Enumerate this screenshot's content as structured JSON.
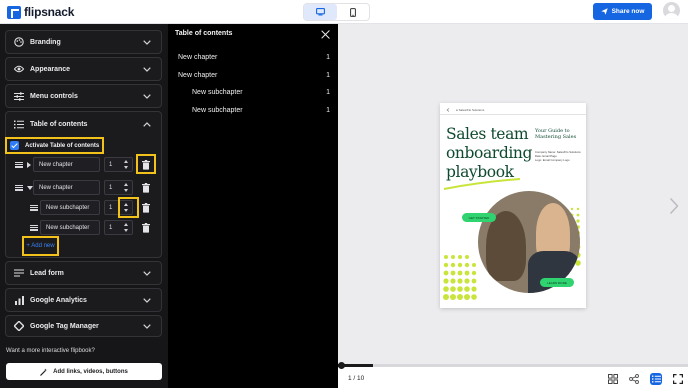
{
  "topbar": {
    "logo_text": "flipsnack",
    "share_label": "Share now",
    "devices": [
      "desktop-icon",
      "mobile-icon"
    ]
  },
  "sidebar": {
    "panels": [
      {
        "label": "Branding",
        "icon": "palette-icon"
      },
      {
        "label": "Appearance",
        "icon": "eye-icon"
      },
      {
        "label": "Menu controls",
        "icon": "sliders-icon"
      },
      {
        "label": "Table of contents",
        "icon": "list-icon"
      },
      {
        "label": "Lead form",
        "icon": "form-icon"
      },
      {
        "label": "Google Analytics",
        "icon": "bar-chart-icon"
      },
      {
        "label": "Google Tag Manager",
        "icon": "diamond-icon"
      }
    ],
    "toc_editor": {
      "activate_label": "Activate Table of contents",
      "activated": true,
      "entries": [
        {
          "name": "New chapter",
          "page": "1",
          "level": 0,
          "expand": "collapsed"
        },
        {
          "name": "New chapter",
          "page": "1",
          "level": 0,
          "expand": "expanded"
        },
        {
          "name": "New subchapter",
          "page": "1",
          "level": 1,
          "expand": "none"
        },
        {
          "name": "New subchapter",
          "page": "1",
          "level": 1,
          "expand": "none"
        }
      ],
      "add_new_label": "+ Add new"
    },
    "promo_text": "Want a more interactive flipbook?",
    "links_button_label": "Add links, videos, buttons"
  },
  "toc_overlay": {
    "title": "Table of contents",
    "items": [
      {
        "label": "New chapter",
        "page": "1",
        "level": 0
      },
      {
        "label": "New chapter",
        "page": "1",
        "level": 0
      },
      {
        "label": "New subchapter",
        "page": "1",
        "level": 1
      },
      {
        "label": "New subchapter",
        "page": "1",
        "level": 1
      }
    ]
  },
  "document_page": {
    "brand": "● Sales/Flo Solutions",
    "title": "Sales team onboarding playbook",
    "subtitle": "Your Guide to Mastering Sales",
    "meta": [
      "Company Name: Sales/Flo Solutions",
      "Date: Email Page",
      "Logo: Email Company Logo"
    ],
    "pill_1": "GET STARTED",
    "pill_2": "LEARN MORE"
  },
  "viewer": {
    "page_counter": "1 / 10",
    "progress_fraction": 0.1,
    "bottom_icons": [
      "grid-icon",
      "share-icon",
      "toc-icon",
      "fullscreen-icon"
    ]
  },
  "colors": {
    "accent": "#1666e2",
    "highlight": "#f3c21a",
    "sidebar_bg": "#161618",
    "title_green": "#0e4a2f",
    "lime": "#c9e43a"
  }
}
